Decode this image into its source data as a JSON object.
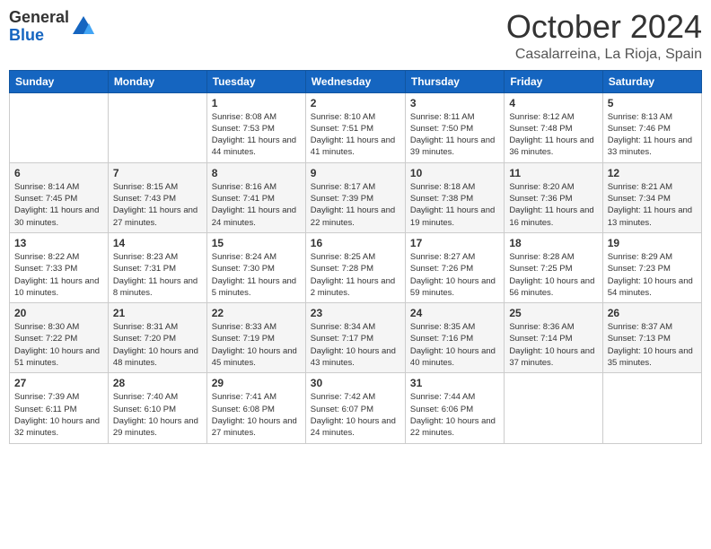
{
  "header": {
    "logo_general": "General",
    "logo_blue": "Blue",
    "month": "October 2024",
    "location": "Casalarreina, La Rioja, Spain"
  },
  "weekdays": [
    "Sunday",
    "Monday",
    "Tuesday",
    "Wednesday",
    "Thursday",
    "Friday",
    "Saturday"
  ],
  "weeks": [
    [
      {
        "day": "",
        "detail": ""
      },
      {
        "day": "",
        "detail": ""
      },
      {
        "day": "1",
        "detail": "Sunrise: 8:08 AM\nSunset: 7:53 PM\nDaylight: 11 hours and 44 minutes."
      },
      {
        "day": "2",
        "detail": "Sunrise: 8:10 AM\nSunset: 7:51 PM\nDaylight: 11 hours and 41 minutes."
      },
      {
        "day": "3",
        "detail": "Sunrise: 8:11 AM\nSunset: 7:50 PM\nDaylight: 11 hours and 39 minutes."
      },
      {
        "day": "4",
        "detail": "Sunrise: 8:12 AM\nSunset: 7:48 PM\nDaylight: 11 hours and 36 minutes."
      },
      {
        "day": "5",
        "detail": "Sunrise: 8:13 AM\nSunset: 7:46 PM\nDaylight: 11 hours and 33 minutes."
      }
    ],
    [
      {
        "day": "6",
        "detail": "Sunrise: 8:14 AM\nSunset: 7:45 PM\nDaylight: 11 hours and 30 minutes."
      },
      {
        "day": "7",
        "detail": "Sunrise: 8:15 AM\nSunset: 7:43 PM\nDaylight: 11 hours and 27 minutes."
      },
      {
        "day": "8",
        "detail": "Sunrise: 8:16 AM\nSunset: 7:41 PM\nDaylight: 11 hours and 24 minutes."
      },
      {
        "day": "9",
        "detail": "Sunrise: 8:17 AM\nSunset: 7:39 PM\nDaylight: 11 hours and 22 minutes."
      },
      {
        "day": "10",
        "detail": "Sunrise: 8:18 AM\nSunset: 7:38 PM\nDaylight: 11 hours and 19 minutes."
      },
      {
        "day": "11",
        "detail": "Sunrise: 8:20 AM\nSunset: 7:36 PM\nDaylight: 11 hours and 16 minutes."
      },
      {
        "day": "12",
        "detail": "Sunrise: 8:21 AM\nSunset: 7:34 PM\nDaylight: 11 hours and 13 minutes."
      }
    ],
    [
      {
        "day": "13",
        "detail": "Sunrise: 8:22 AM\nSunset: 7:33 PM\nDaylight: 11 hours and 10 minutes."
      },
      {
        "day": "14",
        "detail": "Sunrise: 8:23 AM\nSunset: 7:31 PM\nDaylight: 11 hours and 8 minutes."
      },
      {
        "day": "15",
        "detail": "Sunrise: 8:24 AM\nSunset: 7:30 PM\nDaylight: 11 hours and 5 minutes."
      },
      {
        "day": "16",
        "detail": "Sunrise: 8:25 AM\nSunset: 7:28 PM\nDaylight: 11 hours and 2 minutes."
      },
      {
        "day": "17",
        "detail": "Sunrise: 8:27 AM\nSunset: 7:26 PM\nDaylight: 10 hours and 59 minutes."
      },
      {
        "day": "18",
        "detail": "Sunrise: 8:28 AM\nSunset: 7:25 PM\nDaylight: 10 hours and 56 minutes."
      },
      {
        "day": "19",
        "detail": "Sunrise: 8:29 AM\nSunset: 7:23 PM\nDaylight: 10 hours and 54 minutes."
      }
    ],
    [
      {
        "day": "20",
        "detail": "Sunrise: 8:30 AM\nSunset: 7:22 PM\nDaylight: 10 hours and 51 minutes."
      },
      {
        "day": "21",
        "detail": "Sunrise: 8:31 AM\nSunset: 7:20 PM\nDaylight: 10 hours and 48 minutes."
      },
      {
        "day": "22",
        "detail": "Sunrise: 8:33 AM\nSunset: 7:19 PM\nDaylight: 10 hours and 45 minutes."
      },
      {
        "day": "23",
        "detail": "Sunrise: 8:34 AM\nSunset: 7:17 PM\nDaylight: 10 hours and 43 minutes."
      },
      {
        "day": "24",
        "detail": "Sunrise: 8:35 AM\nSunset: 7:16 PM\nDaylight: 10 hours and 40 minutes."
      },
      {
        "day": "25",
        "detail": "Sunrise: 8:36 AM\nSunset: 7:14 PM\nDaylight: 10 hours and 37 minutes."
      },
      {
        "day": "26",
        "detail": "Sunrise: 8:37 AM\nSunset: 7:13 PM\nDaylight: 10 hours and 35 minutes."
      }
    ],
    [
      {
        "day": "27",
        "detail": "Sunrise: 7:39 AM\nSunset: 6:11 PM\nDaylight: 10 hours and 32 minutes."
      },
      {
        "day": "28",
        "detail": "Sunrise: 7:40 AM\nSunset: 6:10 PM\nDaylight: 10 hours and 29 minutes."
      },
      {
        "day": "29",
        "detail": "Sunrise: 7:41 AM\nSunset: 6:08 PM\nDaylight: 10 hours and 27 minutes."
      },
      {
        "day": "30",
        "detail": "Sunrise: 7:42 AM\nSunset: 6:07 PM\nDaylight: 10 hours and 24 minutes."
      },
      {
        "day": "31",
        "detail": "Sunrise: 7:44 AM\nSunset: 6:06 PM\nDaylight: 10 hours and 22 minutes."
      },
      {
        "day": "",
        "detail": ""
      },
      {
        "day": "",
        "detail": ""
      }
    ]
  ]
}
